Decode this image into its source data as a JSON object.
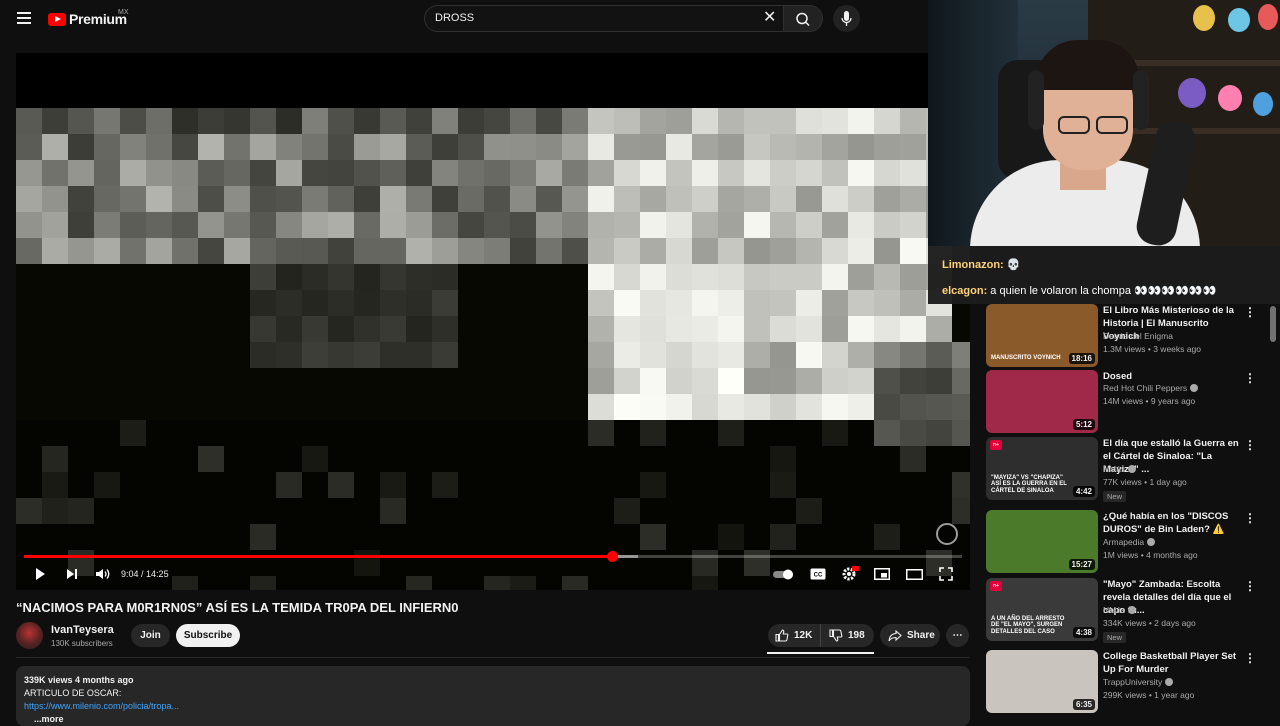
{
  "header": {
    "logo_text": "Premium",
    "country": "MX",
    "search_value": "DROSS"
  },
  "player": {
    "current_time": "9:04",
    "duration": "14:25",
    "progress_fraction": 0.627,
    "buffer_fraction": 0.655
  },
  "video": {
    "title": "“NACIMOS PARA M0R1RN0S” ASÍ ES LA TEMIDA TR0PA DEL INFIERN0",
    "channel": "IvanTeysera",
    "subscribers": "130K subscribers",
    "join_label": "Join",
    "subscribe_label": "Subscribe",
    "likes": "12K",
    "dislikes": "198",
    "share_label": "Share"
  },
  "description": {
    "stats": "339K views  4 months ago",
    "line1": "ARTICULO DE OSCAR:",
    "link": "https://www.milenio.com/policia/tropa...",
    "more": "...more"
  },
  "chat": [
    {
      "user": "Limonazon:",
      "message": "💀"
    },
    {
      "user": "elcagon:",
      "message": "a quien le volaron la chompa 👀👀👀👀👀👀"
    }
  ],
  "recommendations": [
    {
      "title": "El Libro Más Misterioso de la Historia | El Manuscrito Voynich",
      "channel": "Detrás del Enigma",
      "verified": false,
      "meta": "1.3M views • 3 weeks ago",
      "duration": "18:16",
      "badge": "",
      "thumb_text": "MANUSCRITO VOYNICH",
      "thumb_color": "#8a5a2a"
    },
    {
      "title": "Dosed",
      "channel": "Red Hot Chili Peppers",
      "verified": true,
      "meta": "14M views • 9 years ago",
      "duration": "5:12",
      "badge": "",
      "thumb_text": "",
      "thumb_color": "#a0294a"
    },
    {
      "title": "El día que estalló la Guerra en el Cártel de Sinaloa: \"La Mayiza\" ...",
      "channel": "NMás",
      "verified": true,
      "meta": "77K views • 1 day ago",
      "duration": "4:42",
      "badge": "New",
      "thumb_text": "\"MAYIZA\" VS \"CHAPIZA\" ASÍ ES LA GUERRA EN EL CÁRTEL DE SINALOA",
      "thumb_color": "#2e2e2e"
    },
    {
      "title": "¿Qué había en los \"DISCOS DUROS\" de Bin Laden? ⚠️",
      "channel": "Armapedia",
      "verified": true,
      "meta": "1M views • 4 months ago",
      "duration": "15:27",
      "badge": "",
      "thumb_text": "",
      "thumb_color": "#4a7a2a"
    },
    {
      "title": "\"Mayo\" Zambada: Escolta revela detalles del día que el capo fu...",
      "channel": "NMás",
      "verified": true,
      "meta": "334K views • 2 days ago",
      "duration": "4:38",
      "badge": "New",
      "thumb_text": "A UN AÑO DEL ARRESTO DE \"EL MAYO\", SURGEN DETALLES DEL CASO",
      "thumb_color": "#3a3a3a"
    },
    {
      "title": "College Basketball Player Set Up For Murder",
      "channel": "TrappUniversity",
      "verified": true,
      "meta": "299K views • 1 year ago",
      "duration": "6:35",
      "badge": "",
      "thumb_text": "",
      "thumb_color": "#c9c4bd"
    }
  ]
}
